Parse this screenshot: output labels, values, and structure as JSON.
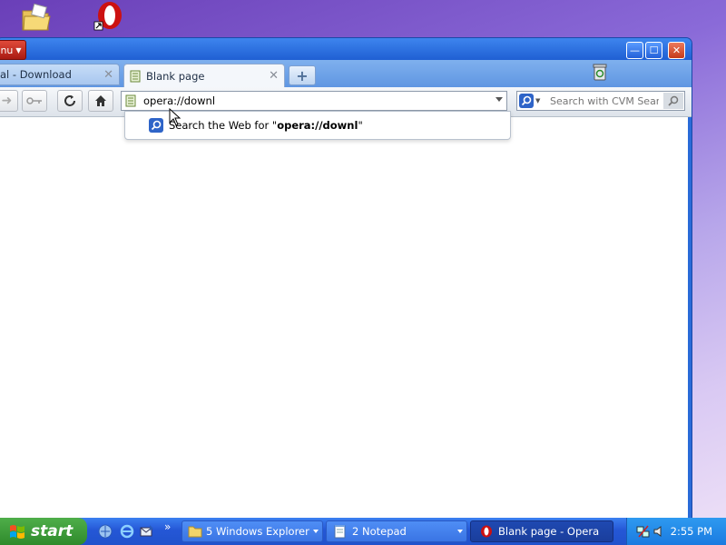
{
  "desktop": {
    "icons": [
      "folder-icon",
      "opera-icon"
    ]
  },
  "window": {
    "menu_label": "nu",
    "tabs": [
      {
        "label": "al - Download",
        "active": false
      },
      {
        "label": "Blank page",
        "active": true
      }
    ],
    "tab_close_glyph": "✕",
    "new_tab_glyph": "+",
    "controls": {
      "minimize": "—",
      "maximize": "☐",
      "close": "✕"
    }
  },
  "toolbar": {
    "address_value": "opera://downl",
    "search_placeholder": "Search with CVM SearXNG"
  },
  "suggestion": {
    "prefix": "Search the Web for \"",
    "query": "opera://downl",
    "suffix": "\""
  },
  "taskbar": {
    "start_label": "start",
    "more_glyph": "»",
    "tasks": [
      {
        "label": "5 Windows Explorer"
      },
      {
        "label": "2 Notepad"
      },
      {
        "label": "Blank page - Opera"
      }
    ],
    "clock": "2:55 PM"
  },
  "colors": {
    "titlebar": "#1f5fd3",
    "taskbar": "#2557d6",
    "start": "#2e8a2b",
    "opera_red": "#cc1111"
  }
}
